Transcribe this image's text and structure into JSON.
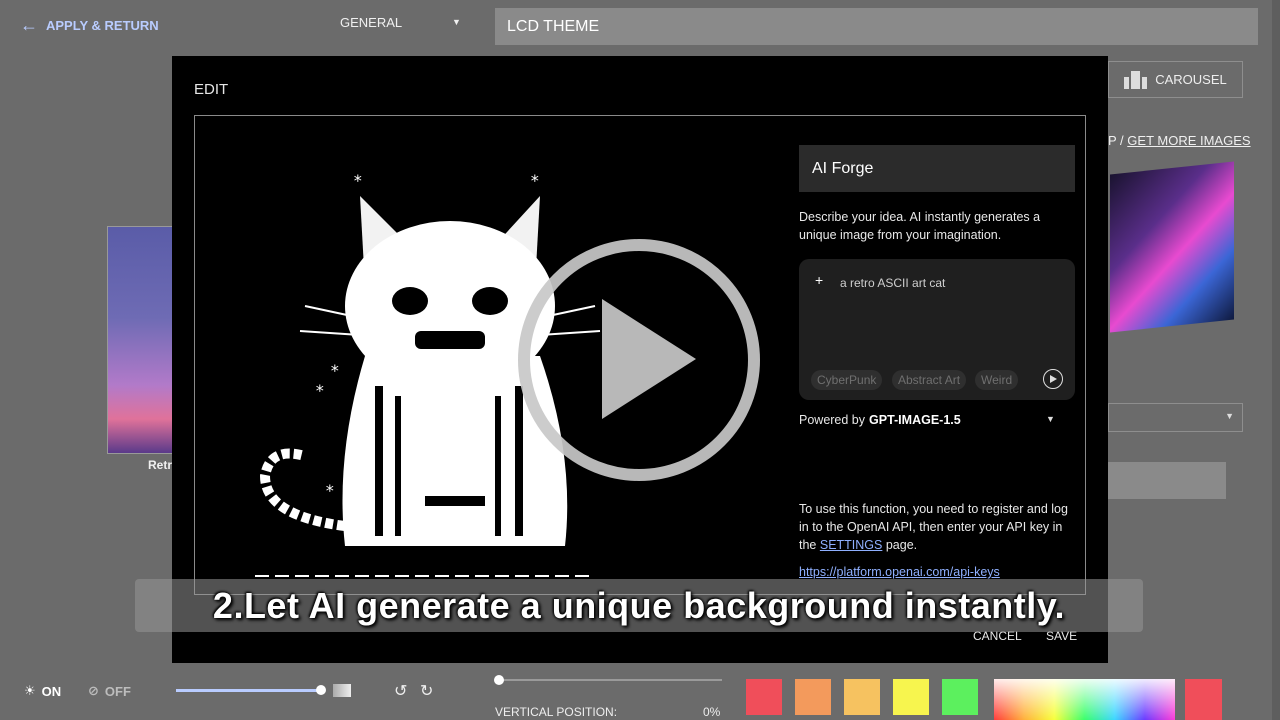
{
  "topbar": {
    "back_label": "APPLY & RETURN",
    "category": "GENERAL",
    "theme_name": "LCD THEME"
  },
  "background_panel": {
    "carousel_label": "CAROUSEL",
    "links_prefix": "P  /  ",
    "get_more_label": "GET MORE IMAGES",
    "thumb_label": "Retr"
  },
  "modal": {
    "title": "EDIT",
    "forge": {
      "title": "AI Forge",
      "description": "Describe your idea. AI instantly generates a unique image from your imagination.",
      "prompt_text": "a retro ASCII art cat",
      "chips": [
        "CyberPunk",
        "Abstract Art",
        "Weird"
      ],
      "powered_by_label": "Powered by",
      "model": "GPT-IMAGE-1.5",
      "api_note_before": "To use this function, you need to register and log in to the OpenAI API, then enter your API key in the ",
      "api_note_link": "SETTINGS",
      "api_note_after": " page.",
      "api_url": "https://platform.openai.com/api-keys"
    },
    "cancel_label": "CANCEL",
    "save_label": "SAVE"
  },
  "caption": "2.Let AI generate a unique background instantly.",
  "bottom": {
    "light_on_label": "ON",
    "light_off_label": "OFF",
    "brightness_level": 1.0,
    "vertical_position_label": "VERTICAL POSITION:",
    "vertical_position_value": "0%",
    "swatch_colors": [
      "#f04e5a",
      "#f39a5c",
      "#f6c260",
      "#f7f54e",
      "#5cf05e"
    ],
    "picker_color": "#f04e5a"
  }
}
